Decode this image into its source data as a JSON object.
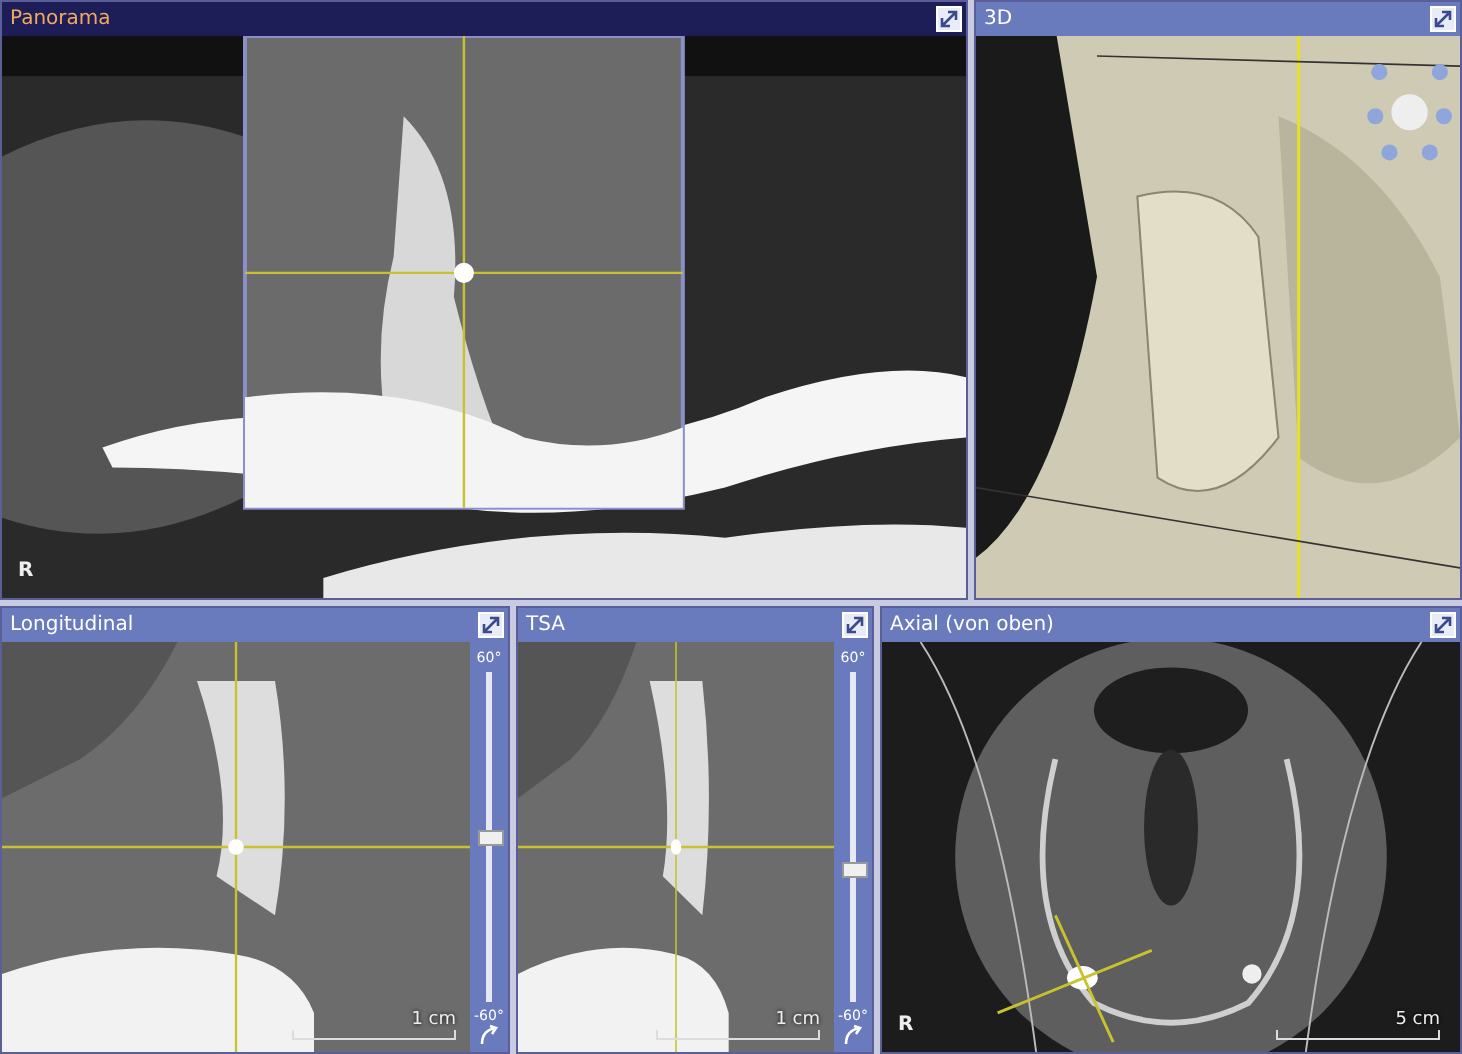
{
  "panels": [
    {
      "title": "Panorama",
      "selected": true,
      "kind": "panorama",
      "orientation_label": "R"
    },
    {
      "title": "3D",
      "selected": false,
      "kind": "volume"
    },
    {
      "title": "Longitudinal",
      "selected": false,
      "kind": "slice",
      "slider": {
        "max_label": "60°",
        "min_label": "-60°",
        "level": 0.5
      },
      "scale_label": "1 cm"
    },
    {
      "title": "TSA",
      "selected": false,
      "kind": "slice",
      "slider": {
        "max_label": "60°",
        "min_label": "-60°",
        "level": 0.4
      },
      "scale_label": "1 cm"
    },
    {
      "title": "Axial (von oben)",
      "selected": false,
      "kind": "axial",
      "orientation_label": "R",
      "scale_label": "5 cm"
    }
  ]
}
